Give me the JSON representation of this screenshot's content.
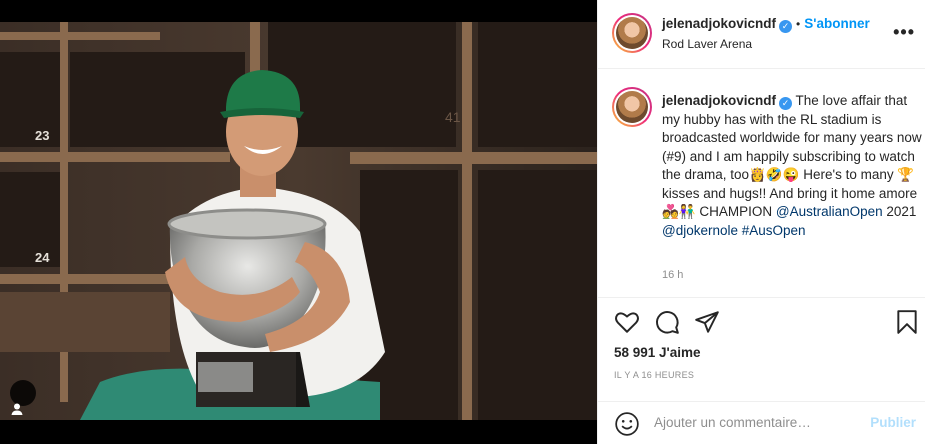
{
  "post": {
    "username": "jelenadjokovicndf",
    "follow_label": "S'abonner",
    "separator": "•",
    "location": "Rod Laver Arena",
    "more_label": "•••",
    "caption": {
      "username": "jelenadjokovicndf",
      "text_1": "The love affair that my hubby has with the RL stadium is broadcasted worldwide for many years now (#9) and I am happily subscribing to watch the drama, too👸🤣😜 Here's to many 🏆 kisses and hugs!! And bring it home amore 💑👫 CHAMPION ",
      "mention_1": "@AustralianOpen",
      "text_2": " 2021 ",
      "mention_2": "@djokernole",
      "hashtag": "#AusOpen"
    },
    "time_ago": "16 h",
    "likes": "58 991 J'aime",
    "date": "IL Y A 16 HEURES",
    "comment_placeholder": "Ajouter un commentaire…",
    "publish_label": "Publier",
    "locker_numbers": [
      "23",
      "24",
      "41"
    ]
  },
  "icons": {
    "verified": "verified-badge-icon",
    "like": "heart-icon",
    "comment": "comment-bubble-icon",
    "share": "paper-plane-icon",
    "save": "bookmark-icon",
    "emoji": "smiley-icon",
    "tag": "user-tag-icon"
  },
  "colors": {
    "link": "#00376b",
    "accent": "#0095f6",
    "publish_disabled": "#b2dffc",
    "verified": "#3897f0"
  }
}
